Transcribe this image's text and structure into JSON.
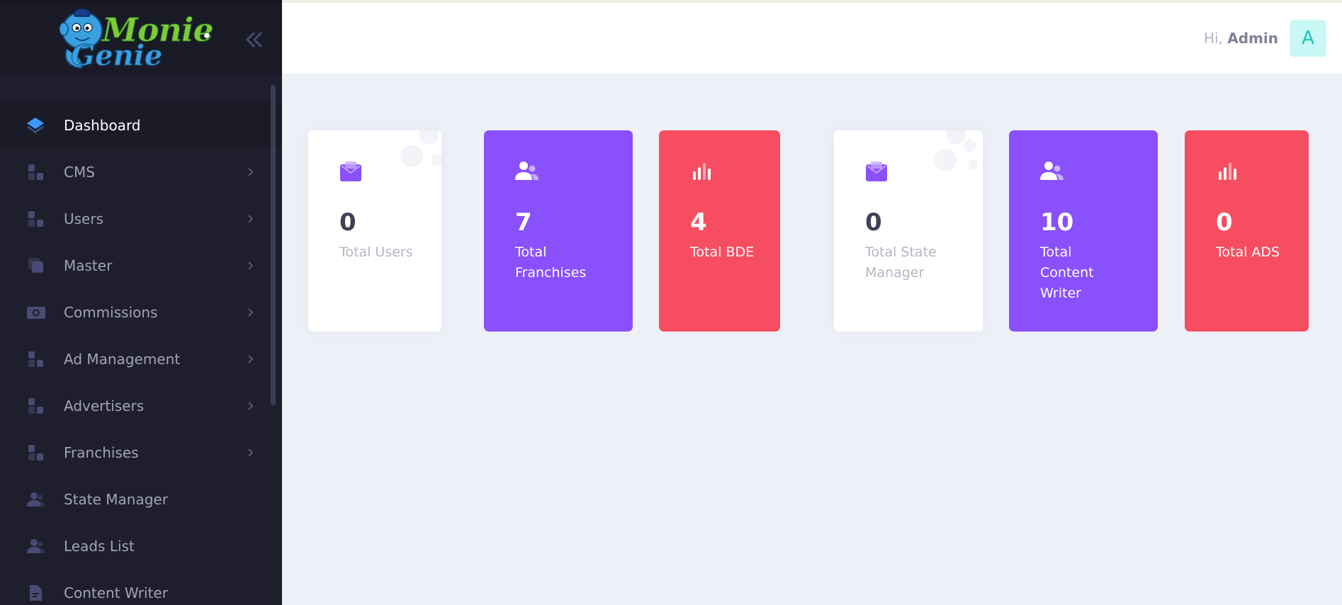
{
  "brand": {
    "logo_text_line1": "Monie",
    "logo_text_line2": "Genie",
    "trademark": "TM"
  },
  "sidebar": {
    "items": [
      {
        "label": "Dashboard",
        "icon": "layers-icon",
        "active": true,
        "has_children": false
      },
      {
        "label": "CMS",
        "icon": "layout-icon",
        "active": false,
        "has_children": true
      },
      {
        "label": "Users",
        "icon": "layout-icon",
        "active": false,
        "has_children": true
      },
      {
        "label": "Master",
        "icon": "duplicate-icon",
        "active": false,
        "has_children": true
      },
      {
        "label": "Commissions",
        "icon": "camera-icon",
        "active": false,
        "has_children": true
      },
      {
        "label": "Ad Management",
        "icon": "layout-icon",
        "active": false,
        "has_children": true
      },
      {
        "label": "Advertisers",
        "icon": "layout-icon",
        "active": false,
        "has_children": true
      },
      {
        "label": "Franchises",
        "icon": "layout-icon",
        "active": false,
        "has_children": true
      },
      {
        "label": "State Manager",
        "icon": "group-icon",
        "active": false,
        "has_children": false
      },
      {
        "label": "Leads List",
        "icon": "group-icon",
        "active": false,
        "has_children": false
      },
      {
        "label": "Content Writer",
        "icon": "file-icon",
        "active": false,
        "has_children": false
      }
    ]
  },
  "header": {
    "greeting": "Hi,",
    "user_name": "Admin",
    "avatar_letter": "A"
  },
  "cards": [
    {
      "value": "0",
      "label": "Total Users",
      "theme": "white",
      "icon": "mail-icon"
    },
    {
      "value": "7",
      "label": "Total Franchises",
      "theme": "purple",
      "icon": "group-icon"
    },
    {
      "value": "4",
      "label": "Total BDE",
      "theme": "red",
      "icon": "chart-bar-icon"
    },
    {
      "value": "0",
      "label": "Total State Manager",
      "theme": "white",
      "icon": "mail-icon"
    },
    {
      "value": "10",
      "label": "Total Content Writer",
      "theme": "purple",
      "icon": "group-icon"
    },
    {
      "value": "0",
      "label": "Total ADS",
      "theme": "red",
      "icon": "chart-bar-icon"
    }
  ],
  "colors": {
    "sidebar_bg": "#1e1e2d",
    "page_bg": "#eef0f8",
    "purple": "#8950fc",
    "red": "#f64e60",
    "accent_blue": "#3699ff",
    "avatar_bg": "#c9f7f5",
    "avatar_text": "#1bc5bd"
  }
}
